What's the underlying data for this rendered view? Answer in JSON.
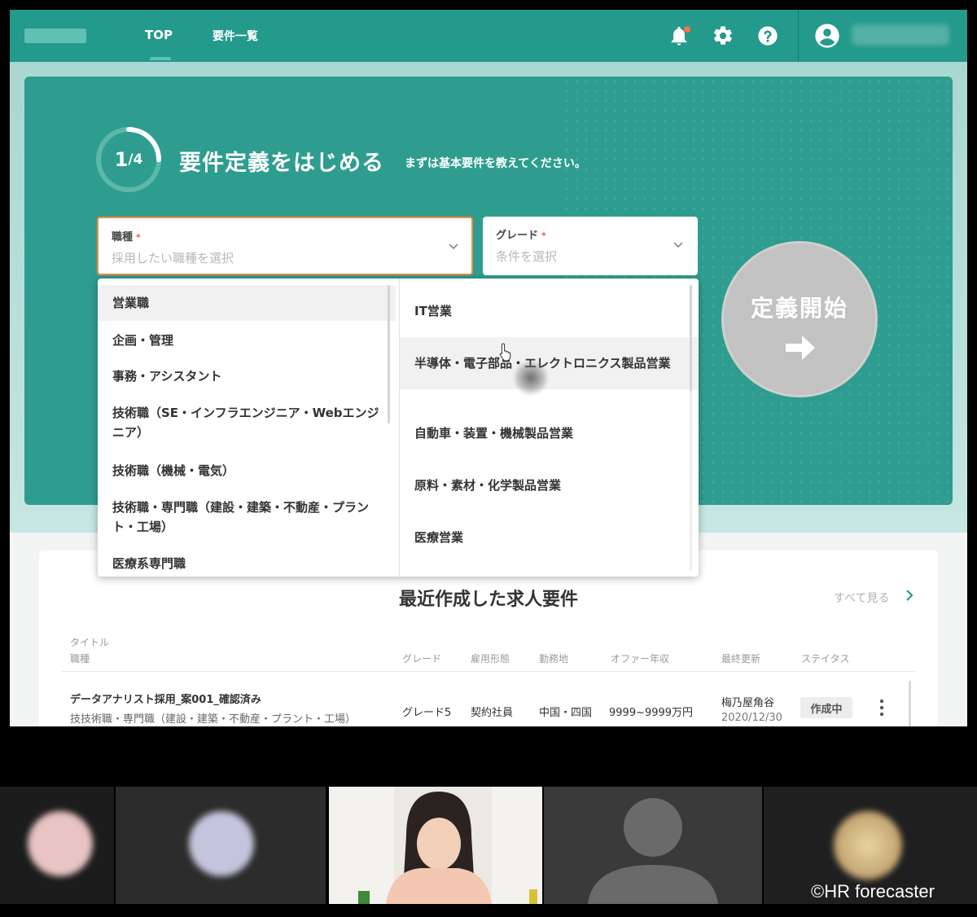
{
  "header": {
    "nav": [
      {
        "label": "TOP"
      },
      {
        "label": "要件一覧"
      }
    ]
  },
  "hero": {
    "progress_current": "1",
    "progress_total": "/4",
    "progress_fraction": 0.25,
    "title": "要件定義をはじめる",
    "subtitle": "まずは基本要件を教えてください。",
    "job_select": {
      "label": "職種",
      "required": "*",
      "placeholder": "採用したい職種を選択"
    },
    "grade_select": {
      "label": "グレード",
      "required": "*",
      "placeholder": "条件を選択"
    },
    "start_button": "定義開始"
  },
  "dropdown": {
    "categories": [
      "営業職",
      "企画・管理",
      "事務・アシスタント",
      "技術職（SE・インフラエンジニア・Webエンジニア）",
      "技術職（機械・電気）",
      "技術職・専門職（建設・建築・不動産・プラント・工場）",
      "医療系専門職"
    ],
    "subcategories": [
      "IT営業",
      "半導体・電子部品・エレクトロニクス製品営業",
      "自動車・装置・機械製品営業",
      "原料・素材・化学製品営業",
      "医療営業"
    ]
  },
  "recent": {
    "title": "最近作成した求人要件",
    "see_all": "すべて見る",
    "columns": {
      "title": "タイトル",
      "job": "職種",
      "grade": "グレード",
      "employment": "雇用形態",
      "location": "勤務地",
      "salary": "オファー年収",
      "updated": "最終更新",
      "status": "ステイタス"
    },
    "rows": [
      {
        "title": "データアナリスト採用_案001_確認済み",
        "job": "技技術職・専門職（建設・建築・不動産・プラント・工場）",
        "grade": "グレード5",
        "employment": "契約社員",
        "location": "中国・四国",
        "salary": "9999~9999万円",
        "updated_by": "梅乃屋角谷",
        "updated_at": "2020/12/30",
        "status": "作成中"
      }
    ]
  },
  "copyright": "©HR forecaster",
  "colors": {
    "primary": "#239a8b",
    "hero": "#2e9d8f",
    "accent_orange": "#f08c3c",
    "notification": "#ff7043"
  }
}
